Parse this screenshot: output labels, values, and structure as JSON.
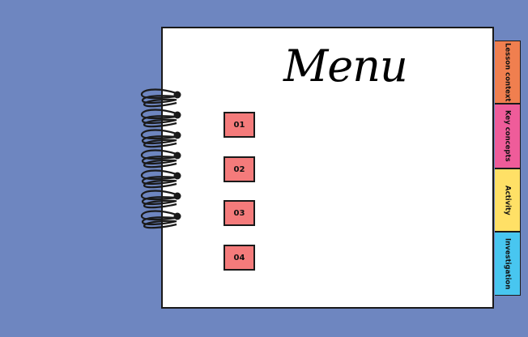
{
  "title": "Menu",
  "menu_items": [
    {
      "label": "01"
    },
    {
      "label": "02"
    },
    {
      "label": "03"
    },
    {
      "label": "04"
    }
  ],
  "tabs": [
    {
      "label": "Lesson context",
      "color": "#f07f4f"
    },
    {
      "label": "Key concepts",
      "color": "#ef5c9a"
    },
    {
      "label": "Activity",
      "color": "#ffe066"
    },
    {
      "label": "Investigation",
      "color": "#48c6f0"
    }
  ],
  "colors": {
    "background": "#6e86c0",
    "button": "#f47b7b"
  }
}
